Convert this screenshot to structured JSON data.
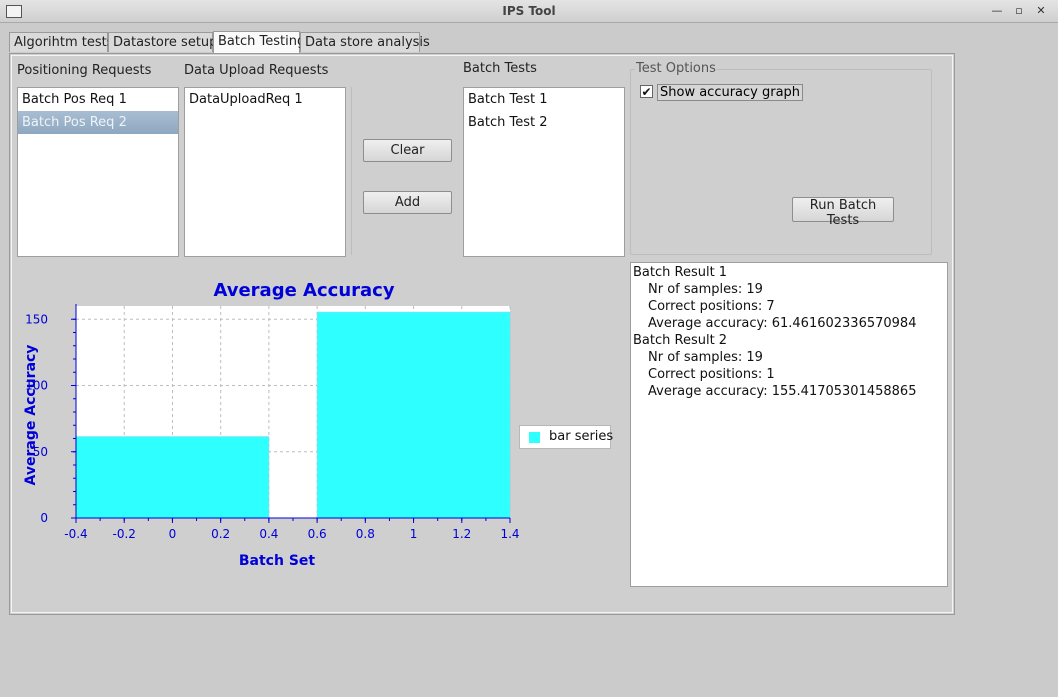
{
  "window": {
    "title": "IPS Tool",
    "controls": {
      "minimize": "—",
      "maximize": "▫",
      "close": "✕"
    }
  },
  "tabs": [
    {
      "label": "Algorihtm tests"
    },
    {
      "label": "Datastore setup"
    },
    {
      "label": "Batch Testing"
    },
    {
      "label": "Data store analysis"
    }
  ],
  "active_tab": "Batch Testing",
  "positioning": {
    "title": "Positioning Requests",
    "items": [
      "Batch Pos Req 1",
      "Batch Pos Req 2"
    ],
    "selected": "Batch Pos Req 2"
  },
  "upload": {
    "title": "Data Upload Requests",
    "items": [
      "DataUploadReq 1"
    ]
  },
  "buttons": {
    "clear": "Clear",
    "add": "Add",
    "run": "Run Batch Tests"
  },
  "batch_tests": {
    "title": "Batch Tests",
    "items": [
      "Batch Test 1",
      "Batch Test 2"
    ]
  },
  "test_options": {
    "title": "Test Options",
    "show_graph_label": "Show accuracy graph",
    "show_graph_checked": true
  },
  "results": [
    {
      "heading": "Batch Result 1",
      "lines": [
        "Nr of samples: 19",
        "Correct positions: 7",
        "Average accuracy: 61.461602336570984"
      ]
    },
    {
      "heading": "Batch Result 2",
      "lines": [
        "Nr of samples: 19",
        "Correct positions: 1",
        "Average accuracy: 155.41705301458865"
      ]
    }
  ],
  "colors": {
    "bar": "#2effff",
    "chart_text": "#0000d8",
    "grid": "#bdbdbd"
  },
  "chart_data": {
    "type": "bar",
    "title": "Average Accuracy",
    "xlabel": "Batch Set",
    "ylabel": "Average Accuracy",
    "bars": [
      {
        "x_start": -0.4,
        "x_end": 0.4,
        "value": 61.461602336570984
      },
      {
        "x_start": 0.6,
        "x_end": 1.4,
        "value": 155.41705301458865
      }
    ],
    "x_ticks": [
      "-0.4",
      "-0.2",
      "0",
      "0.2",
      "0.4",
      "0.6",
      "0.8",
      "1",
      "1.2",
      "1.4"
    ],
    "y_ticks": [
      "0",
      "50",
      "100",
      "150"
    ],
    "xlim": [
      -0.4,
      1.4
    ],
    "ylim": [
      0,
      160
    ],
    "grid": true,
    "legend": {
      "label": "bar series",
      "placement": "right"
    }
  }
}
